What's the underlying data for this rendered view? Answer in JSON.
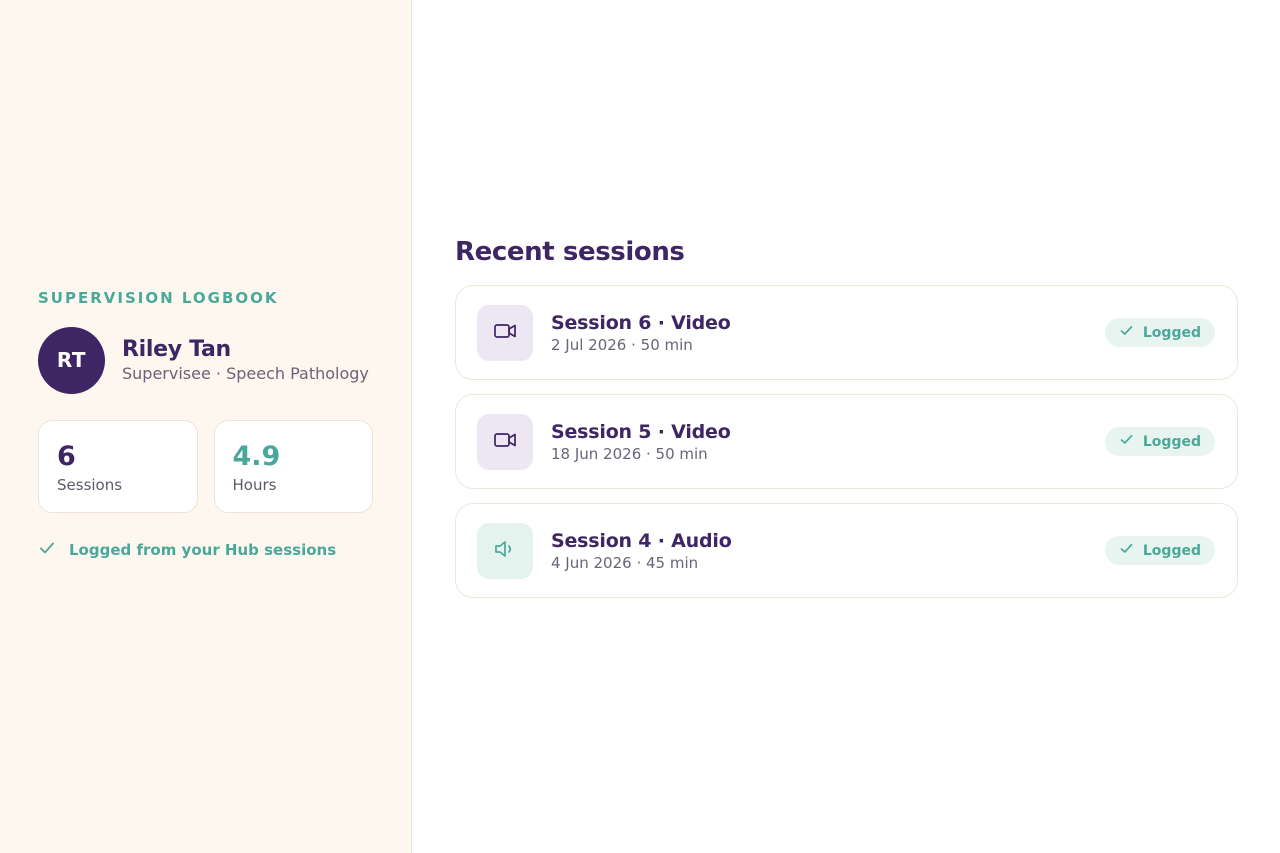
{
  "left": {
    "eyebrow": "SUPERVISION LOGBOOK",
    "profile": {
      "initials": "RT",
      "name": "Riley Tan",
      "role": "Supervisee · Speech Pathology"
    },
    "stats": [
      {
        "value": "6",
        "label": "Sessions"
      },
      {
        "value": "4.9",
        "label": "Hours"
      }
    ],
    "note": "Logged from your Hub sessions"
  },
  "main": {
    "title": "Recent sessions",
    "sessions": [
      {
        "title": "Session 6 · Video",
        "meta": "2 Jul 2026 · 50 min",
        "type_icon": "video-camera-icon",
        "status": "Logged"
      },
      {
        "title": "Session 5 · Video",
        "meta": "18 Jun 2026 · 50 min",
        "type_icon": "video-camera-icon",
        "status": "Logged"
      },
      {
        "title": "Session 4 · Audio",
        "meta": "4 Jun 2026 · 45 min",
        "type_icon": "speaker-icon",
        "status": "Logged"
      }
    ]
  },
  "colors": {
    "brand_purple": "#3e2564",
    "accent_teal": "#4aa89a",
    "sidebar_bg": "#fef7f0"
  }
}
